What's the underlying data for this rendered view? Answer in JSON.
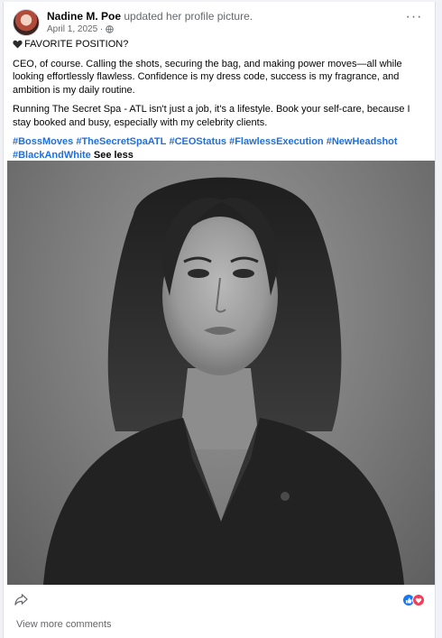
{
  "post": {
    "author": "Nadine M. Poe",
    "action_text": " updated her profile picture.",
    "date": "April 1, 2025 ·",
    "audience_icon": "globe-icon",
    "more_icon": "ellipsis-icon",
    "heading": "FAVORITE POSITION?",
    "heading_icon": "black-heart-icon",
    "paragraph1": "CEO, of course. Calling the shots, securing the bag, and making power moves—all while looking effortlessly flawless. Confidence is my dress code, success is my fragrance, and ambition is my daily routine.",
    "paragraph2": "Running The Secret Spa - ATL isn't just a job, it's a lifestyle. Book your self-care, because I stay booked and busy, especially with my celebrity clients.",
    "hashtags": [
      "#BossMoves",
      "#TheSecretSpaATL",
      "#CEOStatus",
      "#FlawlessExecution",
      "#NewHeadshot",
      "#BlackAndWhite"
    ],
    "see_less": "See less"
  },
  "footer": {
    "share_icon": "share-icon",
    "reactions": [
      "like-icon",
      "love-icon"
    ],
    "view_more_comments": "View more comments"
  },
  "colors": {
    "link": "#216fdb",
    "meta": "#65676b",
    "like": "#1877f2",
    "love": "#f33e58"
  }
}
